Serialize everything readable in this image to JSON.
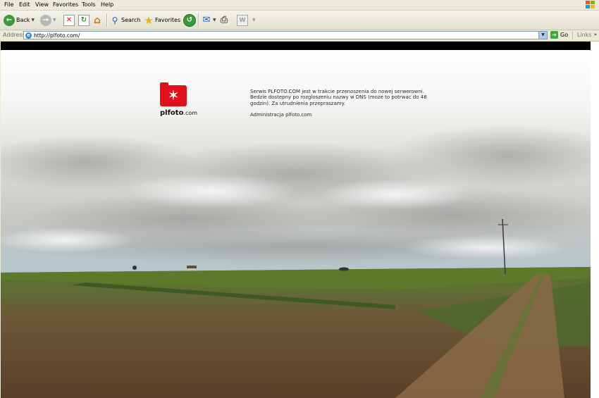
{
  "menu": [
    "File",
    "Edit",
    "View",
    "Favorites",
    "Tools",
    "Help"
  ],
  "toolbar": {
    "back_label": "Back",
    "search_label": "Search",
    "favorites_label": "Favorites"
  },
  "address": {
    "label": "Address",
    "url": "http://plfoto.com/",
    "go_label": "Go",
    "links_label": "Links"
  },
  "page": {
    "logo_name": "plfoto",
    "logo_suffix": ".com",
    "message": "Serwis PLFOTO.COM jest w trakcie przenoszenia do nowej serwerowni. Bedzie dostepny po rozgloszeniu nazwy w DNS (moze to potrwac do 48 godzin). Za utrudnienia przepraszamy.",
    "signature": "Administracja plfoto.com"
  },
  "colors": {
    "logo_red": "#e2101c",
    "chrome_bg": "#ece9d8"
  }
}
